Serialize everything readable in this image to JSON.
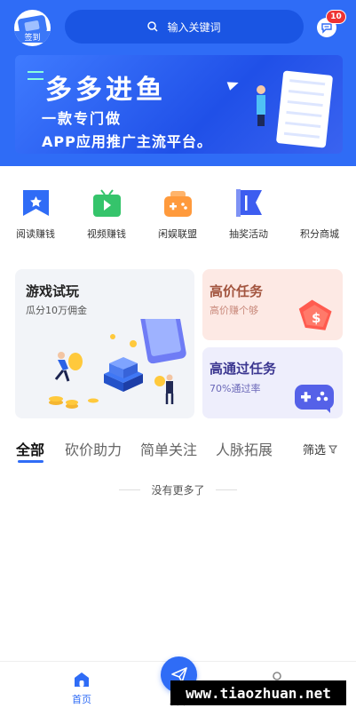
{
  "header": {
    "signin_label": "签到",
    "search_placeholder": "输入关键词",
    "message_count": "10"
  },
  "banner": {
    "title": "多多进鱼",
    "subtitle1": "一款专门做",
    "subtitle2": "APP应用推广主流平台。"
  },
  "quick_links": [
    {
      "label": "阅读赚钱",
      "icon": "reading-flag-icon",
      "color": "#2f6cf6"
    },
    {
      "label": "视频赚钱",
      "icon": "video-tv-icon",
      "color": "#35c46b"
    },
    {
      "label": "闲娱联盟",
      "icon": "gamepad-box-icon",
      "color": "#ff9a3c"
    },
    {
      "label": "抽奖活动",
      "icon": "lottery-flag-icon",
      "color": "#3d5df0"
    },
    {
      "label": "积分商城",
      "icon": "",
      "color": ""
    }
  ],
  "cards": {
    "game": {
      "title": "游戏试玩",
      "subtitle": "瓜分10万佣金"
    },
    "high": {
      "title": "高价任务",
      "subtitle": "高价赚个够"
    },
    "pass": {
      "title": "高通过任务",
      "subtitle": "70%通过率"
    }
  },
  "tabs": [
    "全部",
    "砍价助力",
    "简单关注",
    "人脉拓展"
  ],
  "filter_label": "筛选",
  "empty_text": "没有更多了",
  "tabbar": {
    "home": "首页",
    "publish": "发布",
    "mine": "我的"
  },
  "watermark": "www.tiaozhuan.net",
  "colors": {
    "primary": "#2f6cf6",
    "badge": "#e33333"
  }
}
